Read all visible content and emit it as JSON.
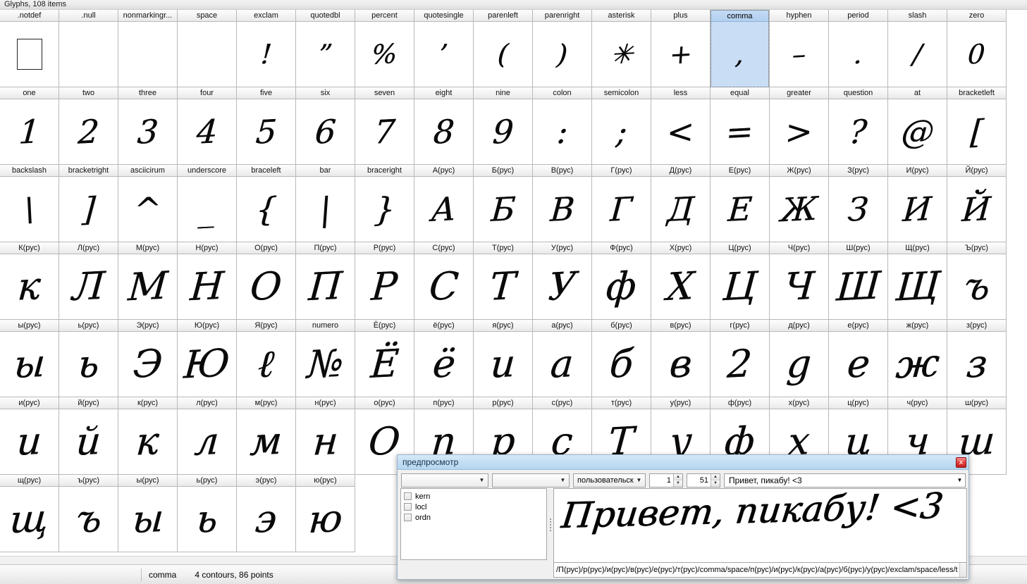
{
  "window": {
    "title": "Glyphs, 108 items"
  },
  "statusbar": {
    "glyph_name": "comma",
    "details": "4 contours, 86 points"
  },
  "grid": {
    "selected_glyph": "comma",
    "rows": [
      [
        {
          "label": ".notdef",
          "glyph": "",
          "kind": "notdef"
        },
        {
          "label": ".null",
          "glyph": ""
        },
        {
          "label": "nonmarkingr...",
          "glyph": ""
        },
        {
          "label": "space",
          "glyph": ""
        },
        {
          "label": "exclam",
          "glyph": "!"
        },
        {
          "label": "quotedbl",
          "glyph": "”"
        },
        {
          "label": "percent",
          "glyph": "%"
        },
        {
          "label": "quotesingle",
          "glyph": "’"
        },
        {
          "label": "parenleft",
          "glyph": "("
        },
        {
          "label": "parenright",
          "glyph": ")"
        },
        {
          "label": "asterisk",
          "glyph": "✳"
        },
        {
          "label": "plus",
          "glyph": "+"
        },
        {
          "label": "comma",
          "glyph": ","
        },
        {
          "label": "hyphen",
          "glyph": "–"
        },
        {
          "label": "period",
          "glyph": "."
        },
        {
          "label": "slash",
          "glyph": "/"
        },
        {
          "label": "zero",
          "glyph": "0"
        }
      ],
      [
        {
          "label": "one",
          "glyph": "1"
        },
        {
          "label": "two",
          "glyph": "2"
        },
        {
          "label": "three",
          "glyph": "3"
        },
        {
          "label": "four",
          "glyph": "4"
        },
        {
          "label": "five",
          "glyph": "5"
        },
        {
          "label": "six",
          "glyph": "6"
        },
        {
          "label": "seven",
          "glyph": "7"
        },
        {
          "label": "eight",
          "glyph": "8"
        },
        {
          "label": "nine",
          "glyph": "9"
        },
        {
          "label": "colon",
          "glyph": ":"
        },
        {
          "label": "semicolon",
          "glyph": ";"
        },
        {
          "label": "less",
          "glyph": "<"
        },
        {
          "label": "equal",
          "glyph": "="
        },
        {
          "label": "greater",
          "glyph": ">"
        },
        {
          "label": "question",
          "glyph": "?"
        },
        {
          "label": "at",
          "glyph": "@"
        },
        {
          "label": "bracketleft",
          "glyph": "["
        }
      ],
      [
        {
          "label": "backslash",
          "glyph": "\\"
        },
        {
          "label": "bracketright",
          "glyph": "]"
        },
        {
          "label": "asciicirum",
          "glyph": "^"
        },
        {
          "label": "underscore",
          "glyph": "_"
        },
        {
          "label": "braceleft",
          "glyph": "{"
        },
        {
          "label": "bar",
          "glyph": "|"
        },
        {
          "label": "braceright",
          "glyph": "}"
        },
        {
          "label": "A(рус)",
          "glyph": "А"
        },
        {
          "label": "Б(рус)",
          "glyph": "Б"
        },
        {
          "label": "В(рус)",
          "glyph": "В"
        },
        {
          "label": "Г(рус)",
          "glyph": "Г"
        },
        {
          "label": "Д(рус)",
          "glyph": "Д"
        },
        {
          "label": "Е(рус)",
          "glyph": "Е"
        },
        {
          "label": "Ж(рус)",
          "glyph": "Ж"
        },
        {
          "label": "З(рус)",
          "glyph": "З"
        },
        {
          "label": "И(рус)",
          "glyph": "И"
        },
        {
          "label": "Й(рус)",
          "glyph": "Й"
        }
      ],
      [
        {
          "label": "К(рус)",
          "glyph": "к"
        },
        {
          "label": "Л(рус)",
          "glyph": "Л"
        },
        {
          "label": "М(рус)",
          "glyph": "М"
        },
        {
          "label": "Н(рус)",
          "glyph": "Н"
        },
        {
          "label": "О(рус)",
          "glyph": "О"
        },
        {
          "label": "П(рус)",
          "glyph": "П"
        },
        {
          "label": "Р(рус)",
          "glyph": "Р"
        },
        {
          "label": "С(рус)",
          "glyph": "С"
        },
        {
          "label": "Т(рус)",
          "glyph": "Т"
        },
        {
          "label": "У(рус)",
          "glyph": "У"
        },
        {
          "label": "Ф(рус)",
          "glyph": "ф"
        },
        {
          "label": "Х(рус)",
          "glyph": "Х"
        },
        {
          "label": "Ц(рус)",
          "glyph": "Ц"
        },
        {
          "label": "Ч(рус)",
          "glyph": "Ч"
        },
        {
          "label": "Ш(рус)",
          "glyph": "Ш"
        },
        {
          "label": "Щ(рус)",
          "glyph": "Щ"
        },
        {
          "label": "Ъ(рус)",
          "glyph": "ъ"
        }
      ],
      [
        {
          "label": "ы(рус)",
          "glyph": "ы"
        },
        {
          "label": "ь(рус)",
          "glyph": "ь"
        },
        {
          "label": "Э(рус)",
          "glyph": "Э"
        },
        {
          "label": "Ю(рус)",
          "glyph": "Ю"
        },
        {
          "label": "Я(рус)",
          "glyph": "ℓ"
        },
        {
          "label": "numero",
          "glyph": "№"
        },
        {
          "label": "Ё(рус)",
          "glyph": "Ё"
        },
        {
          "label": "ё(рус)",
          "glyph": "ё"
        },
        {
          "label": "я(рус)",
          "glyph": "и"
        },
        {
          "label": "а(рус)",
          "glyph": "а"
        },
        {
          "label": "б(рус)",
          "glyph": "б"
        },
        {
          "label": "в(рус)",
          "glyph": "в"
        },
        {
          "label": "г(рус)",
          "glyph": "2"
        },
        {
          "label": "д(рус)",
          "glyph": "g"
        },
        {
          "label": "е(рус)",
          "glyph": "e"
        },
        {
          "label": "ж(рус)",
          "glyph": "ж"
        },
        {
          "label": "з(рус)",
          "glyph": "з"
        }
      ],
      [
        {
          "label": "и(рус)",
          "glyph": "и"
        },
        {
          "label": "й(рус)",
          "glyph": "й"
        },
        {
          "label": "к(рус)",
          "glyph": "к"
        },
        {
          "label": "л(рус)",
          "glyph": "л"
        },
        {
          "label": "м(рус)",
          "glyph": "м"
        },
        {
          "label": "н(рус)",
          "glyph": "н"
        },
        {
          "label": "о(рус)",
          "glyph": "О"
        },
        {
          "label": "п(рус)",
          "glyph": "n"
        },
        {
          "label": "р(рус)",
          "glyph": "р"
        },
        {
          "label": "с(рус)",
          "glyph": "с"
        },
        {
          "label": "т(рус)",
          "glyph": "Т"
        },
        {
          "label": "у(рус)",
          "glyph": "у"
        },
        {
          "label": "ф(рус)",
          "glyph": "ф"
        },
        {
          "label": "х(рус)",
          "glyph": "х"
        },
        {
          "label": "ц(рус)",
          "glyph": "ц"
        },
        {
          "label": "ч(рус)",
          "glyph": "ч"
        },
        {
          "label": "ш(рус)",
          "glyph": "ш"
        }
      ],
      [
        {
          "label": "щ(рус)",
          "glyph": "щ"
        },
        {
          "label": "ъ(рус)",
          "glyph": "ъ"
        },
        {
          "label": "ы(рус)",
          "glyph": "ы"
        },
        {
          "label": "ь(рус)",
          "glyph": "ь"
        },
        {
          "label": "э(рус)",
          "glyph": "э"
        },
        {
          "label": "ю(рус)",
          "glyph": "ю"
        }
      ]
    ]
  },
  "dialog": {
    "title": "предпросмотр",
    "close_label": "x",
    "script_combo": "",
    "language_combo": "",
    "mode_combo": "пользовательск",
    "spin1": "1",
    "spin2": "51",
    "sample_text": "Привет, пикабу! <3",
    "features": [
      "kern",
      "locl",
      "ordn"
    ],
    "preview_render": "Привет, пикабу! <3",
    "glyph_string": "/П(рус)/р(рус)/и(рус)/в(рус)/е(рус)/т(рус)/comma/space/п(рус)/и(рус)/к(рус)/а(рус)/б(рус)/у(рус)/exclam/space/less/t",
    "arrow_down": "▼",
    "spin_up": "▲",
    "spin_dn": "▼"
  }
}
